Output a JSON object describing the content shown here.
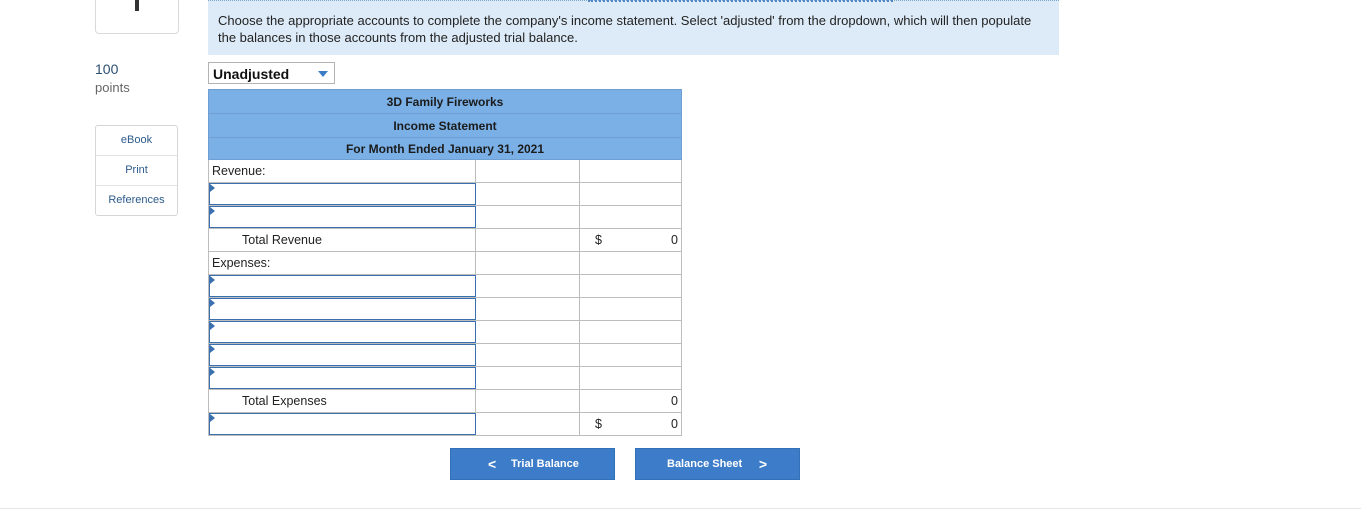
{
  "question": {
    "points_value": "100",
    "points_label": "points"
  },
  "side_links": [
    "eBook",
    "Print",
    "References"
  ],
  "instructions": "Choose the appropriate accounts to complete the company's income statement. Select 'adjusted' from the dropdown, which will then populate the balances in those accounts from the adjusted trial balance.",
  "dropdown": {
    "selected": "Unadjusted"
  },
  "statement": {
    "company": "3D Family Fireworks",
    "title": "Income Statement",
    "period": "For Month Ended January 31, 2021",
    "revenue_label": "Revenue:",
    "total_revenue_label": "Total Revenue",
    "total_revenue_currency": "$",
    "total_revenue_value": "0",
    "expenses_label": "Expenses:",
    "total_expenses_label": "Total Expenses",
    "total_expenses_value": "0",
    "net_currency": "$",
    "net_value": "0"
  },
  "nav": {
    "prev_label": "Trial Balance",
    "next_label": "Balance Sheet",
    "prev_chevron": "<",
    "next_chevron": ">"
  },
  "colors": {
    "header_fill": "#7ab0e6",
    "instruction_bg": "#ddebf8",
    "button_fill": "#3d7cc9",
    "input_border": "#3a6fb0"
  }
}
